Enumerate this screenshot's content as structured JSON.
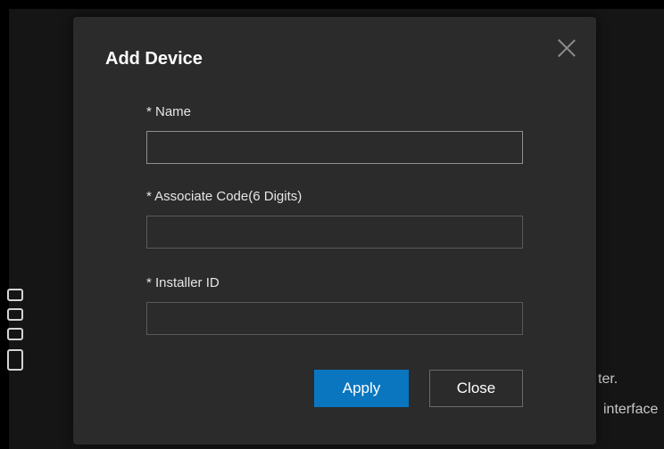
{
  "dialog": {
    "title": "Add Device",
    "fields": [
      {
        "label": "* Name",
        "value": "",
        "placeholder": ""
      },
      {
        "label": "* Associate Code(6 Digits)",
        "value": "",
        "placeholder": ""
      },
      {
        "label": "* Installer ID",
        "value": "",
        "placeholder": ""
      }
    ],
    "buttons": {
      "apply": "Apply",
      "close": "Close"
    }
  },
  "background": {
    "text_line_1": "ter.",
    "text_line_2": "interface"
  },
  "colors": {
    "dialog_bg": "#2b2b2b",
    "accent": "#0a76c0",
    "text": "#ffffff"
  }
}
